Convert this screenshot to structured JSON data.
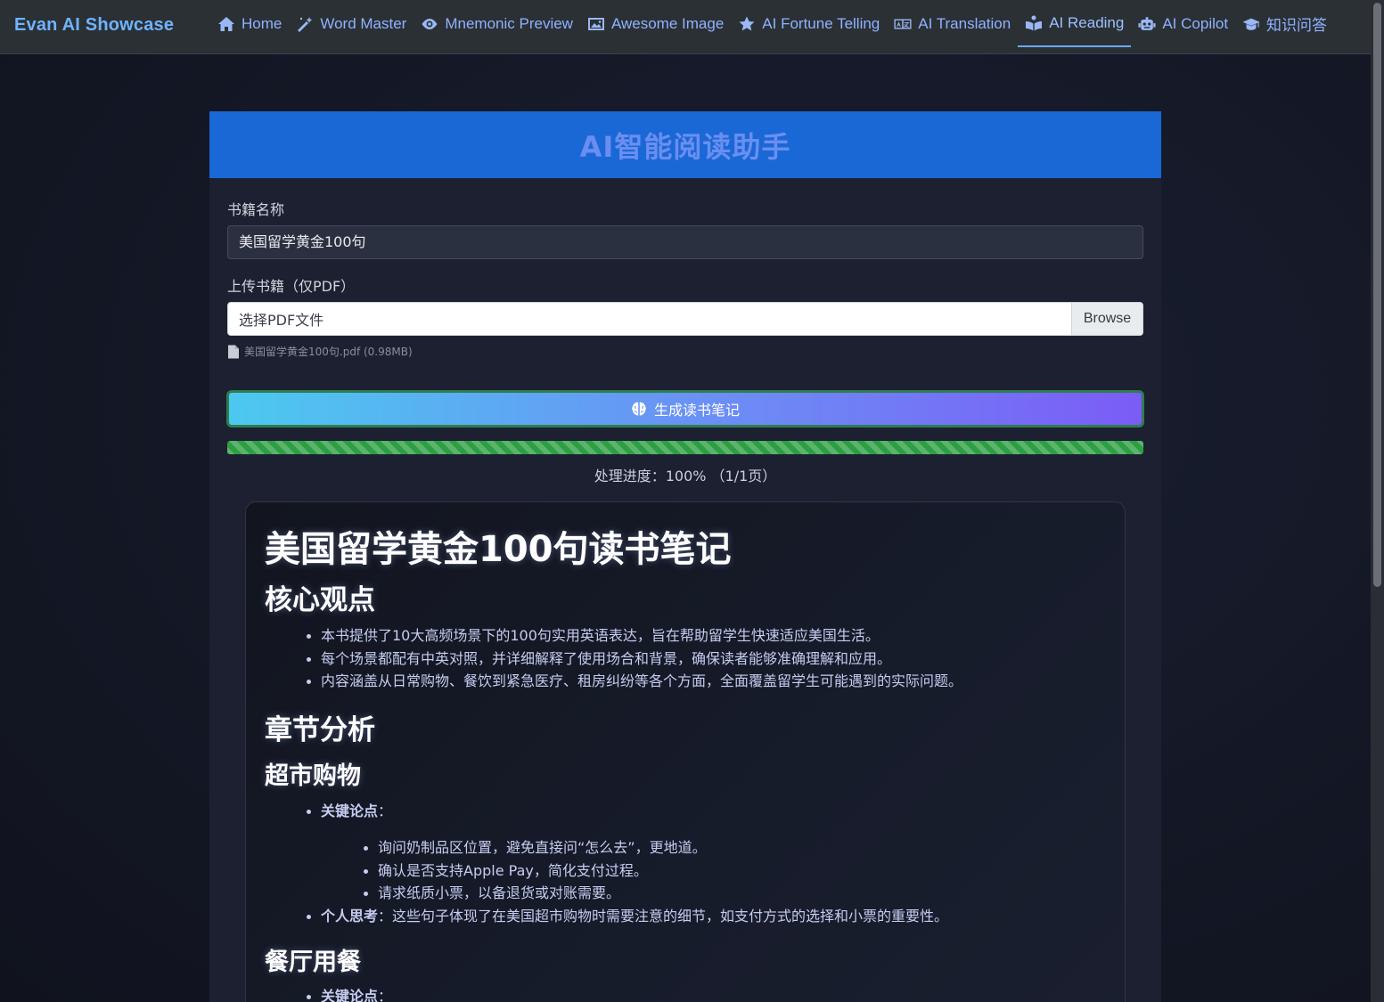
{
  "brand": "Evan AI Showcase",
  "nav": [
    {
      "label": "Home",
      "icon": "home-icon"
    },
    {
      "label": "Word Master",
      "icon": "magic-wand-icon"
    },
    {
      "label": "Mnemonic Preview",
      "icon": "eye-icon"
    },
    {
      "label": "Awesome Image",
      "icon": "image-icon"
    },
    {
      "label": "AI Fortune Telling",
      "icon": "star-icon"
    },
    {
      "label": "AI Translation",
      "icon": "translate-icon"
    },
    {
      "label": "AI Reading",
      "icon": "reader-icon",
      "active": true
    },
    {
      "label": "AI Copilot",
      "icon": "robot-icon"
    },
    {
      "label": "知识问答",
      "icon": "graduation-cap-icon"
    }
  ],
  "card": {
    "title": "AI智能阅读助手",
    "book_name_label": "书籍名称",
    "book_name_value": "美国留学黄金100句",
    "upload_label": "上传书籍（仅PDF）",
    "file_placeholder": "选择PDF文件",
    "browse_label": "Browse",
    "file_info": "美国留学黄金100句.pdf (0.98MB)",
    "generate_label": "生成读书笔记",
    "progress_percent": 100,
    "progress_text": "处理进度：100% （1/1页）"
  },
  "notes": {
    "title": "美国留学黄金100句读书笔记",
    "core_heading": "核心观点",
    "core_points": [
      "本书提供了10大高频场景下的100句实用英语表达，旨在帮助留学生快速适应美国生活。",
      "每个场景都配有中英对照，并详细解释了使用场合和背景，确保读者能够准确理解和应用。",
      "内容涵盖从日常购物、餐饮到紧急医疗、租房纠纷等各个方面，全面覆盖留学生可能遇到的实际问题。"
    ],
    "chapter_heading": "章节分析",
    "section1_heading": "超市购物",
    "key_points_label": "关键论点",
    "section1_points": [
      "询问奶制品区位置，避免直接问“怎么去”，更地道。",
      "确认是否支持Apple Pay，简化支付过程。",
      "请求纸质小票，以备退货或对账需要。"
    ],
    "personal_label": "个人思考",
    "section1_personal": "这些句子体现了在美国超市购物时需要注意的细节，如支付方式的选择和小票的重要性。",
    "section2_heading": "餐厅用餐",
    "colon": "："
  }
}
